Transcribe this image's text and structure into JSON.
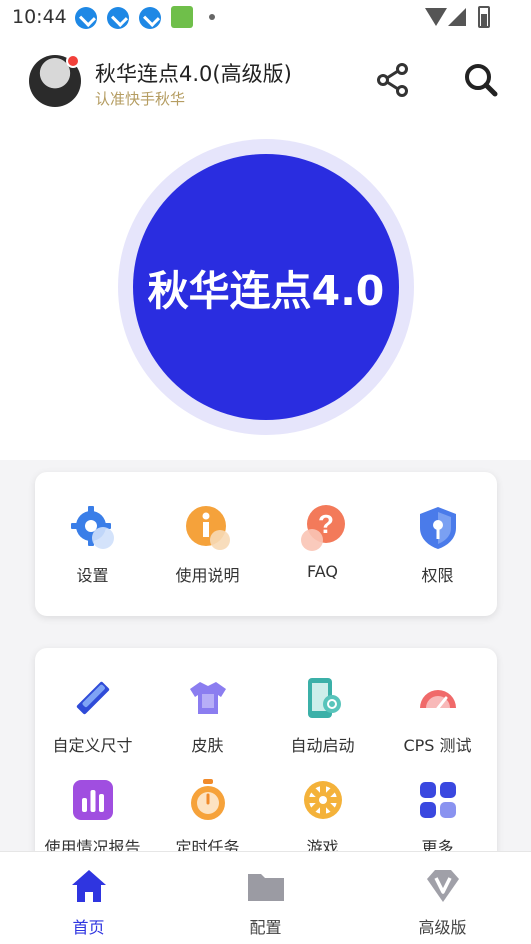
{
  "status_bar": {
    "time": "10:44"
  },
  "header": {
    "title": "秋华连点4.0(高级版)",
    "subtitle": "认准快手秋华",
    "share_icon": "share-icon",
    "search_icon": "search-icon"
  },
  "hero": {
    "label": "秋华连点4.0",
    "color": "#2a2de0",
    "ring_color": "#e6e5fb"
  },
  "main_menu": [
    {
      "label": "设置",
      "icon": "gear-icon"
    },
    {
      "label": "使用说明",
      "icon": "info-icon"
    },
    {
      "label": "FAQ",
      "icon": "question-icon"
    },
    {
      "label": "权限",
      "icon": "shield-key-icon"
    }
  ],
  "tools_menu": [
    {
      "label": "自定义尺寸",
      "icon": "ruler-pencil-icon"
    },
    {
      "label": "皮肤",
      "icon": "tshirt-icon"
    },
    {
      "label": "自动启动",
      "icon": "phone-link-icon"
    },
    {
      "label": "CPS 测试",
      "icon": "speedometer-icon"
    },
    {
      "label": "使用情况报告",
      "icon": "bar-chart-icon"
    },
    {
      "label": "定时任务",
      "icon": "stopwatch-icon"
    },
    {
      "label": "游戏",
      "icon": "wheel-icon"
    },
    {
      "label": "更多",
      "icon": "grid-icon"
    }
  ],
  "bottom_nav": [
    {
      "label": "首页",
      "icon": "home-icon",
      "active": true
    },
    {
      "label": "配置",
      "icon": "folder-icon",
      "active": false
    },
    {
      "label": "高级版",
      "icon": "diamond-v-icon",
      "active": false
    }
  ],
  "colors": {
    "accent": "#2f35e0",
    "subtitle": "#b59d62",
    "badge": "#f2403a"
  }
}
